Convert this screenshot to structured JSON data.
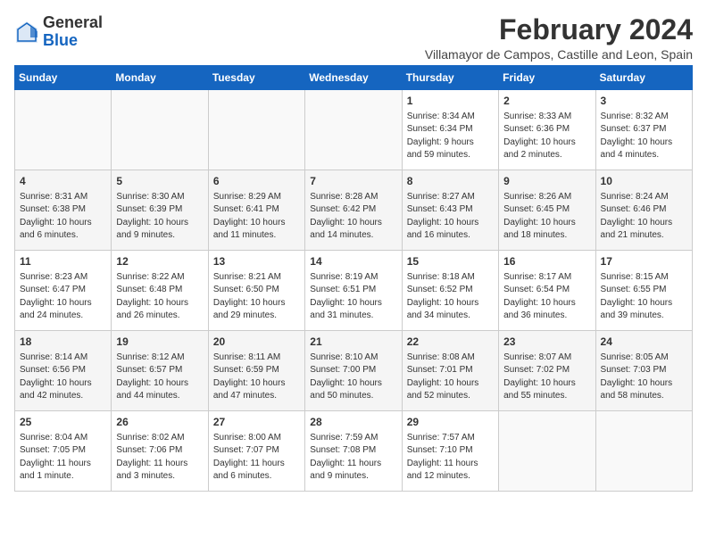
{
  "logo": {
    "general": "General",
    "blue": "Blue"
  },
  "header": {
    "title": "February 2024",
    "subtitle": "Villamayor de Campos, Castille and Leon, Spain"
  },
  "weekdays": [
    "Sunday",
    "Monday",
    "Tuesday",
    "Wednesday",
    "Thursday",
    "Friday",
    "Saturday"
  ],
  "weeks": [
    [
      {
        "day": "",
        "info": ""
      },
      {
        "day": "",
        "info": ""
      },
      {
        "day": "",
        "info": ""
      },
      {
        "day": "",
        "info": ""
      },
      {
        "day": "1",
        "info": "Sunrise: 8:34 AM\nSunset: 6:34 PM\nDaylight: 9 hours\nand 59 minutes."
      },
      {
        "day": "2",
        "info": "Sunrise: 8:33 AM\nSunset: 6:36 PM\nDaylight: 10 hours\nand 2 minutes."
      },
      {
        "day": "3",
        "info": "Sunrise: 8:32 AM\nSunset: 6:37 PM\nDaylight: 10 hours\nand 4 minutes."
      }
    ],
    [
      {
        "day": "4",
        "info": "Sunrise: 8:31 AM\nSunset: 6:38 PM\nDaylight: 10 hours\nand 6 minutes."
      },
      {
        "day": "5",
        "info": "Sunrise: 8:30 AM\nSunset: 6:39 PM\nDaylight: 10 hours\nand 9 minutes."
      },
      {
        "day": "6",
        "info": "Sunrise: 8:29 AM\nSunset: 6:41 PM\nDaylight: 10 hours\nand 11 minutes."
      },
      {
        "day": "7",
        "info": "Sunrise: 8:28 AM\nSunset: 6:42 PM\nDaylight: 10 hours\nand 14 minutes."
      },
      {
        "day": "8",
        "info": "Sunrise: 8:27 AM\nSunset: 6:43 PM\nDaylight: 10 hours\nand 16 minutes."
      },
      {
        "day": "9",
        "info": "Sunrise: 8:26 AM\nSunset: 6:45 PM\nDaylight: 10 hours\nand 18 minutes."
      },
      {
        "day": "10",
        "info": "Sunrise: 8:24 AM\nSunset: 6:46 PM\nDaylight: 10 hours\nand 21 minutes."
      }
    ],
    [
      {
        "day": "11",
        "info": "Sunrise: 8:23 AM\nSunset: 6:47 PM\nDaylight: 10 hours\nand 24 minutes."
      },
      {
        "day": "12",
        "info": "Sunrise: 8:22 AM\nSunset: 6:48 PM\nDaylight: 10 hours\nand 26 minutes."
      },
      {
        "day": "13",
        "info": "Sunrise: 8:21 AM\nSunset: 6:50 PM\nDaylight: 10 hours\nand 29 minutes."
      },
      {
        "day": "14",
        "info": "Sunrise: 8:19 AM\nSunset: 6:51 PM\nDaylight: 10 hours\nand 31 minutes."
      },
      {
        "day": "15",
        "info": "Sunrise: 8:18 AM\nSunset: 6:52 PM\nDaylight: 10 hours\nand 34 minutes."
      },
      {
        "day": "16",
        "info": "Sunrise: 8:17 AM\nSunset: 6:54 PM\nDaylight: 10 hours\nand 36 minutes."
      },
      {
        "day": "17",
        "info": "Sunrise: 8:15 AM\nSunset: 6:55 PM\nDaylight: 10 hours\nand 39 minutes."
      }
    ],
    [
      {
        "day": "18",
        "info": "Sunrise: 8:14 AM\nSunset: 6:56 PM\nDaylight: 10 hours\nand 42 minutes."
      },
      {
        "day": "19",
        "info": "Sunrise: 8:12 AM\nSunset: 6:57 PM\nDaylight: 10 hours\nand 44 minutes."
      },
      {
        "day": "20",
        "info": "Sunrise: 8:11 AM\nSunset: 6:59 PM\nDaylight: 10 hours\nand 47 minutes."
      },
      {
        "day": "21",
        "info": "Sunrise: 8:10 AM\nSunset: 7:00 PM\nDaylight: 10 hours\nand 50 minutes."
      },
      {
        "day": "22",
        "info": "Sunrise: 8:08 AM\nSunset: 7:01 PM\nDaylight: 10 hours\nand 52 minutes."
      },
      {
        "day": "23",
        "info": "Sunrise: 8:07 AM\nSunset: 7:02 PM\nDaylight: 10 hours\nand 55 minutes."
      },
      {
        "day": "24",
        "info": "Sunrise: 8:05 AM\nSunset: 7:03 PM\nDaylight: 10 hours\nand 58 minutes."
      }
    ],
    [
      {
        "day": "25",
        "info": "Sunrise: 8:04 AM\nSunset: 7:05 PM\nDaylight: 11 hours\nand 1 minute."
      },
      {
        "day": "26",
        "info": "Sunrise: 8:02 AM\nSunset: 7:06 PM\nDaylight: 11 hours\nand 3 minutes."
      },
      {
        "day": "27",
        "info": "Sunrise: 8:00 AM\nSunset: 7:07 PM\nDaylight: 11 hours\nand 6 minutes."
      },
      {
        "day": "28",
        "info": "Sunrise: 7:59 AM\nSunset: 7:08 PM\nDaylight: 11 hours\nand 9 minutes."
      },
      {
        "day": "29",
        "info": "Sunrise: 7:57 AM\nSunset: 7:10 PM\nDaylight: 11 hours\nand 12 minutes."
      },
      {
        "day": "",
        "info": ""
      },
      {
        "day": "",
        "info": ""
      }
    ]
  ]
}
